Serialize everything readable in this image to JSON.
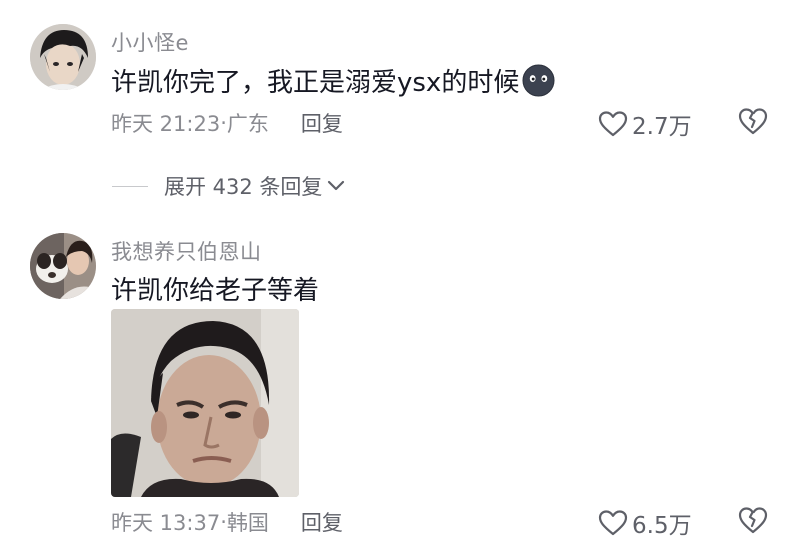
{
  "comments": [
    {
      "username": "小小怪e",
      "text": "许凯你完了，我正是溺爱ysx的时候",
      "emoji_icon": "dark-round-face-emoji",
      "time": "昨天 21:23",
      "separator": "·",
      "location": "广东",
      "reply_label": "回复",
      "likes": "2.7万"
    },
    {
      "username": "我想养只伯恩山",
      "text": "许凯你给老子等着",
      "image_icon": "meme-face-sticker",
      "time": "昨天 13:37",
      "separator": "·",
      "location": "韩国",
      "reply_label": "回复",
      "likes": "6.5万"
    }
  ],
  "expand": {
    "label": "展开 432 条回复"
  },
  "icons": {
    "like": "heart-outline-icon",
    "dislike": "broken-heart-icon",
    "expand": "chevron-down-icon"
  },
  "colors": {
    "text_primary": "#161823",
    "text_secondary": "#8a8b91",
    "text_action": "#5e6068"
  }
}
